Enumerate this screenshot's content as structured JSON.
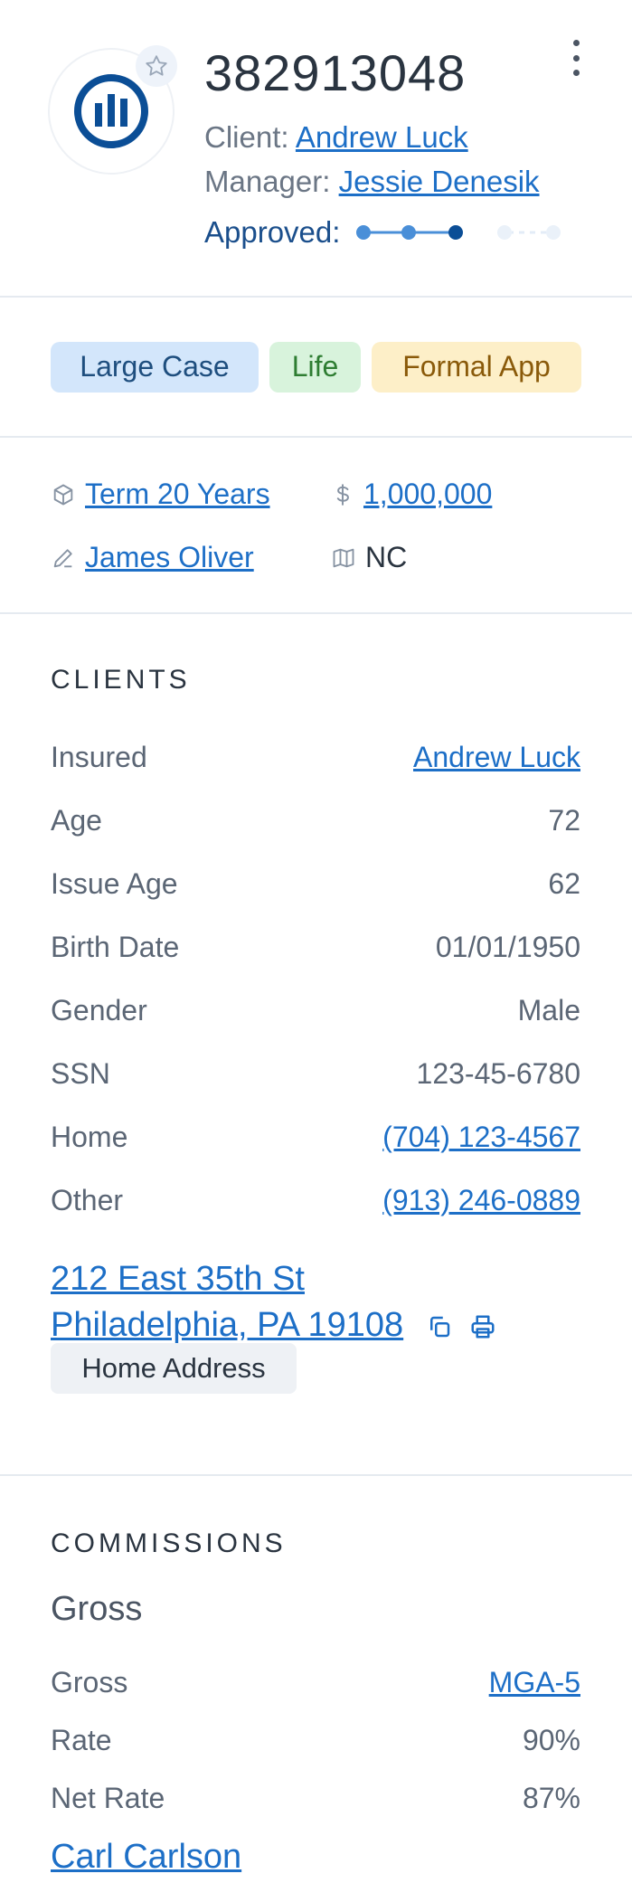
{
  "header": {
    "policy_number": "382913048",
    "client_label": "Client:",
    "client_name": "Andrew Luck",
    "manager_label": "Manager:",
    "manager_name": "Jessie Denesik",
    "approved_label": "Approved:",
    "approval_progress": {
      "completed_steps": 3,
      "total_steps": 5
    },
    "icons": [
      "carrier-logo-icon",
      "star-icon",
      "more-vertical-icon"
    ],
    "colors": {
      "brand": "#0b4e96",
      "accent": "#1d6fc7"
    }
  },
  "chips": [
    {
      "label": "Large Case",
      "color": "#d3e6fb"
    },
    {
      "label": "Life",
      "color": "#d8f3dc"
    },
    {
      "label": "Formal App",
      "color": "#fdefc8"
    }
  ],
  "info": {
    "product": {
      "icon": "cube-icon",
      "value": "Term 20 Years"
    },
    "face_amount": {
      "icon": "dollar-icon",
      "value": "1,000,000"
    },
    "agent": {
      "icon": "pencil-icon",
      "value": "James Oliver"
    },
    "state": {
      "icon": "map-icon",
      "value": "NC"
    }
  },
  "clients": {
    "title": "CLIENTS",
    "rows": [
      {
        "label": "Insured",
        "value": "Andrew Luck",
        "link": true
      },
      {
        "label": "Age",
        "value": "72",
        "link": false
      },
      {
        "label": "Issue Age",
        "value": "62",
        "link": false
      },
      {
        "label": "Birth Date",
        "value": "01/01/1950",
        "link": false
      },
      {
        "label": "Gender",
        "value": "Male",
        "link": false
      },
      {
        "label": "SSN",
        "value": "123-45-6780",
        "link": false
      },
      {
        "label": "Home",
        "value": "(704) 123-4567",
        "link": true
      },
      {
        "label": "Other",
        "value": "(913) 246-0889",
        "link": true
      }
    ],
    "address_line1": "212 East 35th St",
    "address_line2": "Philadelphia, PA 19108",
    "address_icons": [
      "copy-icon",
      "print-icon"
    ],
    "address_tag": "Home Address"
  },
  "commissions": {
    "title": "COMMISSIONS",
    "subtitle": "Gross",
    "rows": [
      {
        "label": "Gross",
        "value": "MGA-5",
        "link": true
      },
      {
        "label": "Rate",
        "value": "90%",
        "link": false
      },
      {
        "label": "Net Rate",
        "value": "87%",
        "link": false
      }
    ],
    "agent_name": "Carl Carlson"
  }
}
